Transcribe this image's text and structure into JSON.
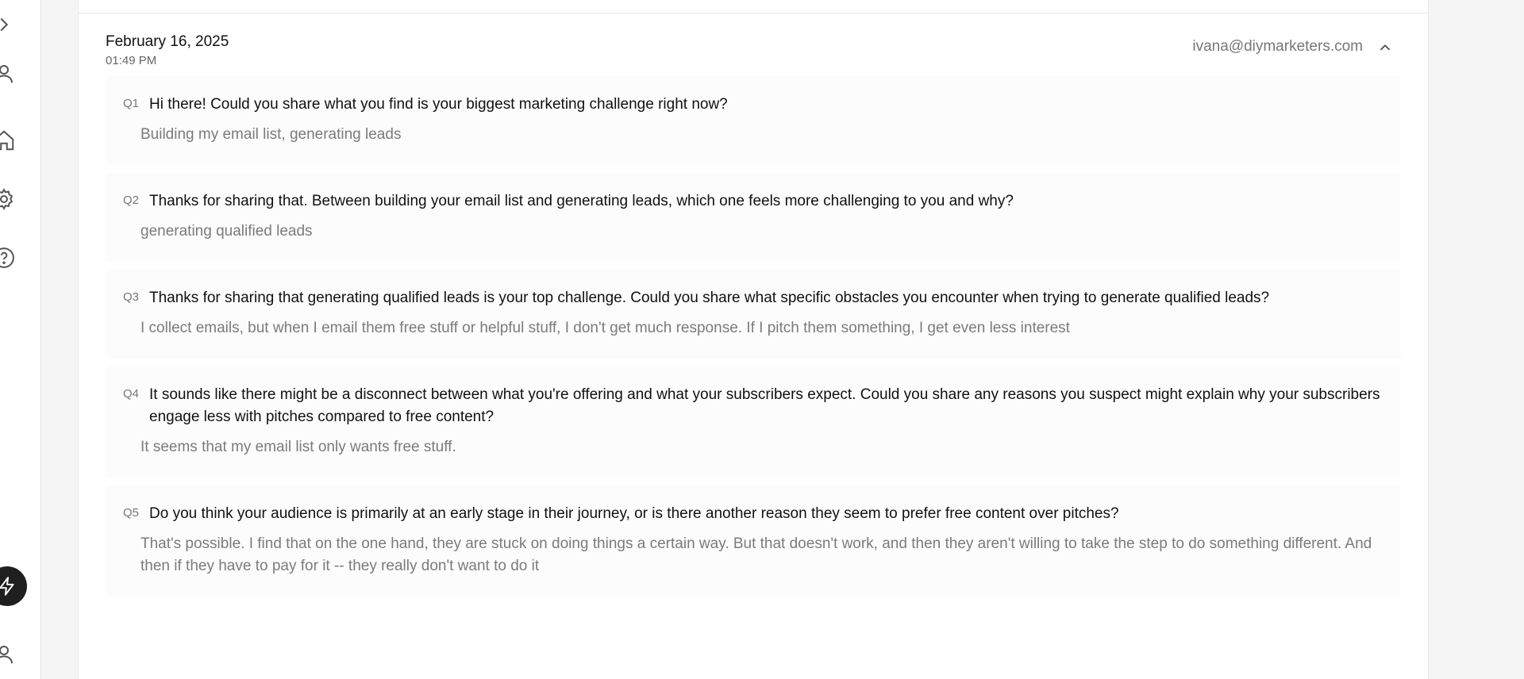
{
  "sidebar": {
    "icons": [
      "chevron-right-icon",
      "user-icon",
      "home-icon",
      "gear-icon",
      "help-icon",
      "bolt-icon",
      "user-icon"
    ]
  },
  "entry": {
    "date": "February 16, 2025",
    "time": "01:49 PM",
    "email": "ivana@diymarketers.com",
    "collapse_icon": "chevron-up-icon"
  },
  "qa": [
    {
      "num": "Q1",
      "question": "Hi there! Could you share what you find is your biggest marketing challenge right now?",
      "answer": "Building my email list, generating leads"
    },
    {
      "num": "Q2",
      "question": "Thanks for sharing that. Between building your email list and generating leads, which one feels more challenging to you and why?",
      "answer": "generating qualified leads"
    },
    {
      "num": "Q3",
      "question": "Thanks for sharing that generating qualified leads is your top challenge. Could you share what specific obstacles you encounter when trying to generate qualified leads?",
      "answer": "I collect emails, but when I email them free stuff or helpful stuff, I don't get much response. If I pitch them something, I get even less interest"
    },
    {
      "num": "Q4",
      "question": "It sounds like there might be a disconnect between what you're offering and what your subscribers expect. Could you share any reasons you suspect might explain why your subscribers engage less with pitches compared to free content?",
      "answer": "It seems that my email list only wants free stuff."
    },
    {
      "num": "Q5",
      "question": "Do you think your audience is primarily at an early stage in their journey, or is there another reason they seem to prefer free content over pitches?",
      "answer": "That's possible. I find that on the one hand, they are stuck on doing things a certain way. But that doesn't work, and then they aren't willing to take the step to do something different. And then if they have to pay for it -- they really don't want to do it"
    }
  ]
}
